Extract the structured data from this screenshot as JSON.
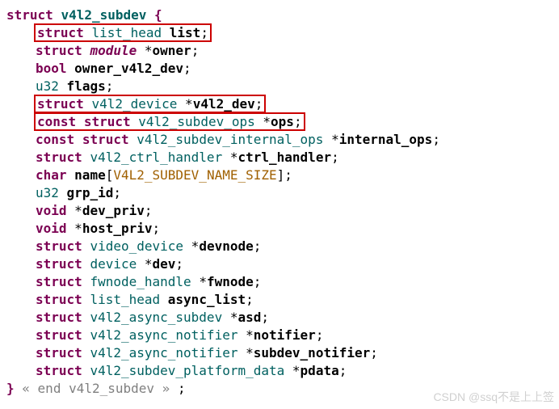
{
  "header": {
    "kw_struct": "struct",
    "typename": "v4l2_subdev",
    "open_brace": "{"
  },
  "lines": [
    {
      "kw": "struct",
      "type": "list_head",
      "name": "list",
      "boxed": true
    },
    {
      "kw": "struct",
      "type_italic": "module",
      "star": "*",
      "name": "owner"
    },
    {
      "type_raw": "bool",
      "name": "owner_v4l2_dev"
    },
    {
      "type_raw_teal": "u32",
      "name": "flags"
    },
    {
      "kw": "struct",
      "type": "v4l2_device",
      "star": "*",
      "name": "v4l2_dev",
      "boxed": true
    },
    {
      "kw_const": "const",
      "kw": "struct",
      "type": "v4l2_subdev_ops",
      "star": "*",
      "name": "ops",
      "boxed": true
    },
    {
      "kw_const": "const",
      "kw": "struct",
      "type": "v4l2_subdev_internal_ops",
      "star": "*",
      "name": "internal_ops"
    },
    {
      "kw": "struct",
      "type": "v4l2_ctrl_handler",
      "star": "*",
      "name": "ctrl_handler"
    },
    {
      "kw_char": "char",
      "name": "name",
      "array_macro": "V4L2_SUBDEV_NAME_SIZE"
    },
    {
      "type_raw_teal": "u32",
      "name": "grp_id"
    },
    {
      "kw_void": "void",
      "star": "*",
      "name": "dev_priv"
    },
    {
      "kw_void": "void",
      "star": "*",
      "name": "host_priv"
    },
    {
      "kw": "struct",
      "type": "video_device",
      "star": "*",
      "name": "devnode"
    },
    {
      "kw": "struct",
      "type": "device",
      "star": "*",
      "name": "dev"
    },
    {
      "kw": "struct",
      "type": "fwnode_handle",
      "star": "*",
      "name": "fwnode"
    },
    {
      "kw": "struct",
      "type": "list_head",
      "name": "async_list"
    },
    {
      "kw": "struct",
      "type": "v4l2_async_subdev",
      "star": "*",
      "name": "asd"
    },
    {
      "kw": "struct",
      "type": "v4l2_async_notifier",
      "star": "*",
      "name": "notifier"
    },
    {
      "kw": "struct",
      "type": "v4l2_async_notifier",
      "star": "*",
      "name": "subdev_notifier"
    },
    {
      "kw": "struct",
      "type": "v4l2_subdev_platform_data",
      "star": "*",
      "name": "pdata"
    }
  ],
  "footer": {
    "close_brace": "}",
    "comment": "« end v4l2_subdev »",
    "semi": ";"
  },
  "watermark": "CSDN @ssq不是上上签"
}
